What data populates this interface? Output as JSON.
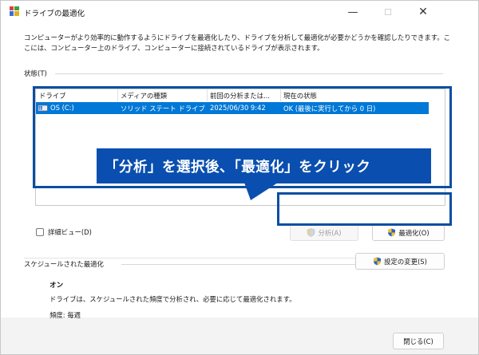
{
  "window": {
    "title": "ドライブの最適化",
    "controls": {
      "minimize": "—",
      "maximize": "☐",
      "close": "✕"
    }
  },
  "description": "コンピューターがより効率的に動作するようにドライブを最適化したり、ドライブを分析して最適化が必要かどうかを確認したりできます。ここには、コンピューター上のドライブ、コンピューターに接続されているドライブが表示されます。",
  "status": {
    "label": "状態(T)",
    "columns": [
      "ドライブ",
      "メディアの種類",
      "前回の分析または...",
      "現在の状態"
    ],
    "rows": [
      {
        "drive": "OS (C:)",
        "media": "ソリッド ステート ドライブ",
        "last_analyzed": "2025/06/30 9:42",
        "current_status": "OK (最後に実行してから 0 日)"
      }
    ]
  },
  "callout": {
    "text": "「分析」を選択後、「最適化」をクリック",
    "color": "#0a4faf"
  },
  "detail_view": {
    "label": "詳細ビュー(D)",
    "checked": false
  },
  "buttons": {
    "analyze": "分析(A)",
    "optimize": "最適化(O)",
    "change_settings": "設定の変更(S)",
    "close": "閉じる(C)"
  },
  "schedule": {
    "label": "スケジュールされた最適化",
    "state": "オン",
    "description": "ドライブは、スケジュールされた頻度で分析され、必要に応じて最適化されます。",
    "frequency": "頻度: 毎週"
  },
  "colors": {
    "accent": "#0078d7",
    "highlight_border": "#0b4ea2"
  }
}
